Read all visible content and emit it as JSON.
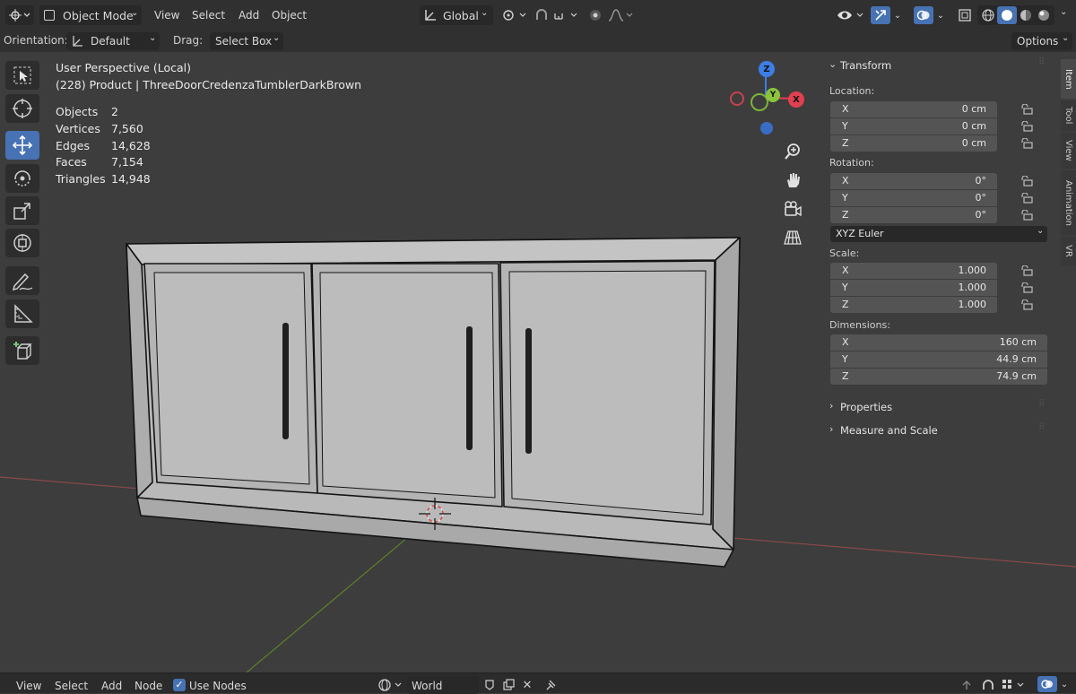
{
  "header": {
    "mode": "Object Mode",
    "menu": [
      "View",
      "Select",
      "Add",
      "Object"
    ],
    "orientation_global": "Global"
  },
  "tool_settings": {
    "orientation_label": "Orientation:",
    "orientation_value": "Default",
    "drag_label": "Drag:",
    "drag_value": "Select Box",
    "options": "Options"
  },
  "overlay": {
    "perspective": "User Perspective (Local)",
    "object_name": "(228) Product | ThreeDoorCredenzaTumblerDarkBrown",
    "stats": [
      {
        "label": "Objects",
        "value": "2"
      },
      {
        "label": "Vertices",
        "value": "7,560"
      },
      {
        "label": "Edges",
        "value": "14,628"
      },
      {
        "label": "Faces",
        "value": "7,154"
      },
      {
        "label": "Triangles",
        "value": "14,948"
      }
    ]
  },
  "gizmo": {
    "x": "X",
    "y": "Y",
    "z": "Z"
  },
  "panel": {
    "transform_title": "Transform",
    "location_label": "Location:",
    "location": [
      {
        "axis": "X",
        "value": "0 cm"
      },
      {
        "axis": "Y",
        "value": "0 cm"
      },
      {
        "axis": "Z",
        "value": "0 cm"
      }
    ],
    "rotation_label": "Rotation:",
    "rotation": [
      {
        "axis": "X",
        "value": "0°"
      },
      {
        "axis": "Y",
        "value": "0°"
      },
      {
        "axis": "Z",
        "value": "0°"
      }
    ],
    "rotation_mode": "XYZ Euler",
    "scale_label": "Scale:",
    "scale": [
      {
        "axis": "X",
        "value": "1.000"
      },
      {
        "axis": "Y",
        "value": "1.000"
      },
      {
        "axis": "Z",
        "value": "1.000"
      }
    ],
    "dimensions_label": "Dimensions:",
    "dimensions": [
      {
        "axis": "X",
        "value": "160 cm"
      },
      {
        "axis": "Y",
        "value": "44.9 cm"
      },
      {
        "axis": "Z",
        "value": "74.9 cm"
      }
    ],
    "properties": "Properties",
    "measure_scale": "Measure and Scale"
  },
  "side_tabs": [
    "Item",
    "Tool",
    "View",
    "Animation",
    "VR"
  ],
  "bottom_bar": {
    "menu": [
      "View",
      "Select",
      "Add",
      "Node"
    ],
    "use_nodes": "Use Nodes",
    "world": "World"
  }
}
